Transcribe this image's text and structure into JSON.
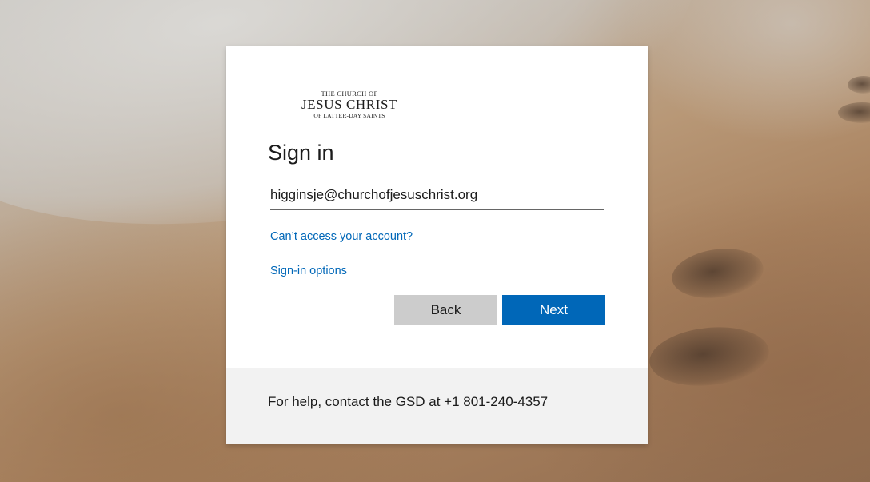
{
  "logo": {
    "line1": "THE CHURCH OF",
    "line2": "JESUS CHRIST",
    "line3": "OF LATTER-DAY SAINTS"
  },
  "signin": {
    "title": "Sign in",
    "email_value": "higginsje@churchofjesuschrist.org",
    "cant_access_link": "Can’t access your account?",
    "signin_options_link": "Sign-in options",
    "back_label": "Back",
    "next_label": "Next"
  },
  "footer": {
    "help_text": "For help, contact the GSD at +1 801-240-4357"
  },
  "colors": {
    "accent": "#0067b8",
    "back_button": "#cccccc",
    "footer_bg": "#f2f2f2"
  }
}
